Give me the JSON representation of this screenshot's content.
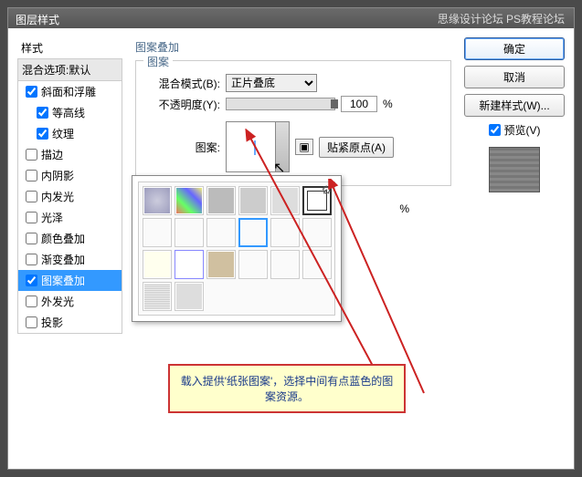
{
  "window": {
    "title": "图层样式"
  },
  "watermark": {
    "text1": "思缘设计论坛",
    "text2": "PS教程论坛"
  },
  "sidebar": {
    "title": "样式",
    "blend_header": "混合选项:默认",
    "items": [
      {
        "label": "斜面和浮雕",
        "checked": true,
        "sub": false
      },
      {
        "label": "等高线",
        "checked": true,
        "sub": true
      },
      {
        "label": "纹理",
        "checked": true,
        "sub": true
      },
      {
        "label": "描边",
        "checked": false,
        "sub": false
      },
      {
        "label": "内阴影",
        "checked": false,
        "sub": false
      },
      {
        "label": "内发光",
        "checked": false,
        "sub": false
      },
      {
        "label": "光泽",
        "checked": false,
        "sub": false
      },
      {
        "label": "颜色叠加",
        "checked": false,
        "sub": false
      },
      {
        "label": "渐变叠加",
        "checked": false,
        "sub": false
      },
      {
        "label": "图案叠加",
        "checked": true,
        "sub": false,
        "selected": true
      },
      {
        "label": "外发光",
        "checked": false,
        "sub": false
      },
      {
        "label": "投影",
        "checked": false,
        "sub": false
      }
    ]
  },
  "main": {
    "title": "图案叠加",
    "fieldset_title": "图案",
    "blend_mode_label": "混合模式(B):",
    "blend_mode_value": "正片叠底",
    "opacity_label": "不透明度(Y):",
    "opacity_value": "100",
    "percent": "%",
    "pattern_label": "图案:",
    "snap_btn": "贴紧原点(A)",
    "scale_percent": "%"
  },
  "right": {
    "ok": "确定",
    "cancel": "取消",
    "new_style": "新建样式(W)...",
    "preview": "预览(V)"
  },
  "callout": {
    "text": "载入提供'纸张图案'，选择中间有点蓝色的图案资源。"
  }
}
